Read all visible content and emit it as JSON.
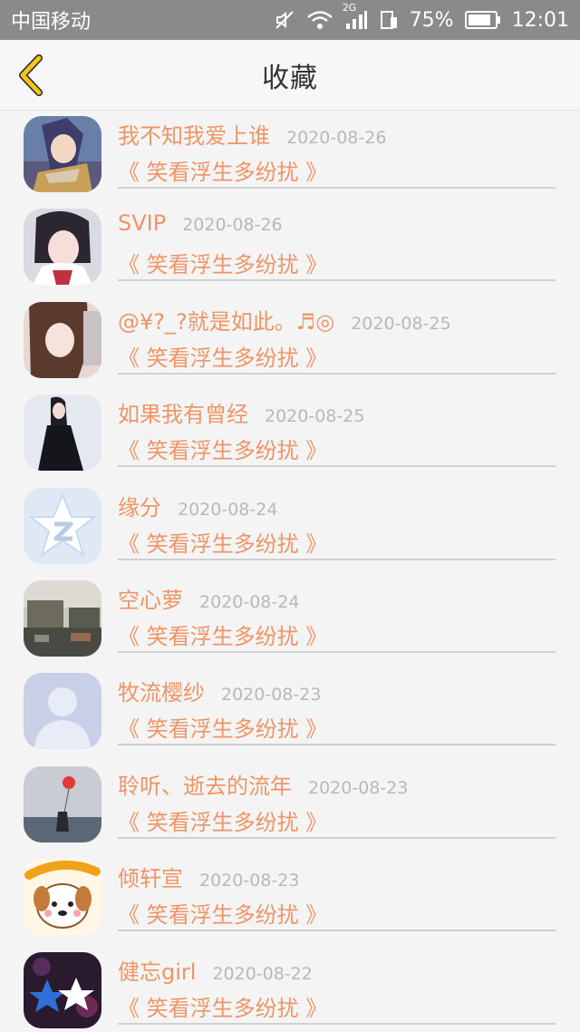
{
  "status_bar": {
    "carrier": "中国移动",
    "network": "2G",
    "battery": "75%",
    "time": "12:01",
    "icons": [
      "mute-icon",
      "wifi-icon",
      "signal-icon",
      "sim-icon",
      "battery-icon"
    ]
  },
  "header": {
    "title": "收藏",
    "back_icon": "chevron-left-icon",
    "accent_color": "#f5c518"
  },
  "colors": {
    "name_text": "#ee9566",
    "date_text": "#b8b8b8",
    "background": "#f4f4f4"
  },
  "favorites": [
    {
      "name": "我不知我爱上谁",
      "date": "2020-08-26",
      "work": "《 笑看浮生多纷扰 》",
      "avatar": "anime-character-avatar"
    },
    {
      "name": "SVIP",
      "date": "2020-08-26",
      "work": "《 笑看浮生多纷扰 》",
      "avatar": "girl-portrait-avatar"
    },
    {
      "name": "@¥?_?就是如此。♬◎",
      "date": "2020-08-25",
      "work": "《 笑看浮生多纷扰 》",
      "avatar": "girl-selfie-avatar"
    },
    {
      "name": "如果我有曾经",
      "date": "2020-08-25",
      "work": "《 笑看浮生多纷扰 》",
      "avatar": "girl-black-dress-avatar"
    },
    {
      "name": "缘分",
      "date": "2020-08-24",
      "work": "《 笑看浮生多纷扰 》",
      "avatar": "qq-star-default-avatar"
    },
    {
      "name": "空心萝",
      "date": "2020-08-24",
      "work": "《 笑看浮生多纷扰 》",
      "avatar": "street-scene-avatar"
    },
    {
      "name": "牧流樱纱",
      "date": "2020-08-23",
      "work": "《 笑看浮生多纷扰 》",
      "avatar": "default-person-avatar"
    },
    {
      "name": "聆听、逝去的流年",
      "date": "2020-08-23",
      "work": "《 笑看浮生多纷扰 》",
      "avatar": "girl-balloon-sea-avatar"
    },
    {
      "name": "倾轩宣",
      "date": "2020-08-23",
      "work": "《 笑看浮生多纷扰 》",
      "avatar": "good-day-dog-avatar"
    },
    {
      "name": "健忘girl",
      "date": "2020-08-22",
      "work": "《 笑看浮生多纷扰 》",
      "avatar": "star-plush-avatar"
    }
  ]
}
